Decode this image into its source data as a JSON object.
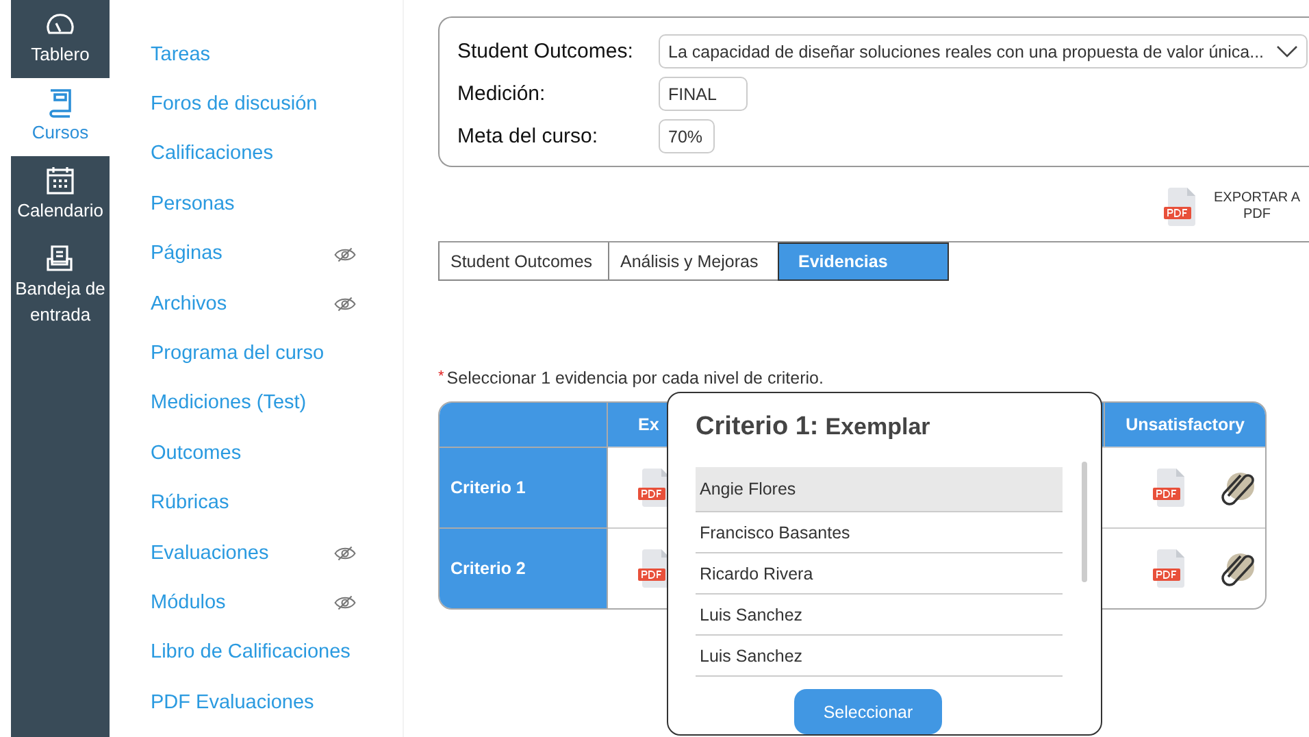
{
  "global_nav": [
    {
      "label": "Tablero",
      "selected": false
    },
    {
      "label": "Cursos",
      "selected": true
    },
    {
      "label": "Calendario",
      "selected": false
    },
    {
      "label": "Bandeja de entrada",
      "selected": false
    }
  ],
  "course_nav": [
    {
      "label": "Tareas",
      "hidden": false
    },
    {
      "label": "Foros de discusión",
      "hidden": false
    },
    {
      "label": "Calificaciones",
      "hidden": false
    },
    {
      "label": "Personas",
      "hidden": false
    },
    {
      "label": "Páginas",
      "hidden": true
    },
    {
      "label": "Archivos",
      "hidden": true
    },
    {
      "label": "Programa del curso",
      "hidden": false
    },
    {
      "label": "Mediciones (Test)",
      "hidden": false
    },
    {
      "label": "Outcomes",
      "hidden": false
    },
    {
      "label": "Rúbricas",
      "hidden": false
    },
    {
      "label": "Evaluaciones",
      "hidden": true
    },
    {
      "label": "Módulos",
      "hidden": true
    },
    {
      "label": "Libro de Calificaciones",
      "hidden": false
    },
    {
      "label": "PDF Evaluaciones",
      "hidden": false
    }
  ],
  "filters": {
    "outcome_label": "Student Outcomes:",
    "outcome_value": "La capacidad de diseñar soluciones reales con una propuesta de valor única...",
    "measurement_label": "Medición:",
    "measurement_value": "FINAL",
    "goal_label": "Meta del curso:",
    "goal_value": "70%"
  },
  "export_button": "EXPORTAR A PDF",
  "tabs": [
    {
      "label": "Student Outcomes",
      "selected": false
    },
    {
      "label": "Análisis y Mejoras",
      "selected": false
    },
    {
      "label": "Evidencias",
      "selected": true
    }
  ],
  "note": {
    "mark": "*",
    "text": "Seleccionar 1 evidencia por cada nivel de criterio."
  },
  "table": {
    "columns": [
      "Ex",
      "Unsatisfactory"
    ],
    "rows": [
      {
        "label": "Criterio 1"
      },
      {
        "label": "Criterio 2"
      }
    ]
  },
  "dialog": {
    "criterion": "Criterio 1:",
    "level": "Exemplar",
    "items": [
      {
        "name": "Angie Flores",
        "selected": true
      },
      {
        "name": "Francisco Basantes",
        "selected": false
      },
      {
        "name": "Ricardo Rivera",
        "selected": false
      },
      {
        "name": "Luis Sanchez",
        "selected": false
      },
      {
        "name": "Luis Sanchez",
        "selected": false
      }
    ],
    "button": "Seleccionar"
  }
}
